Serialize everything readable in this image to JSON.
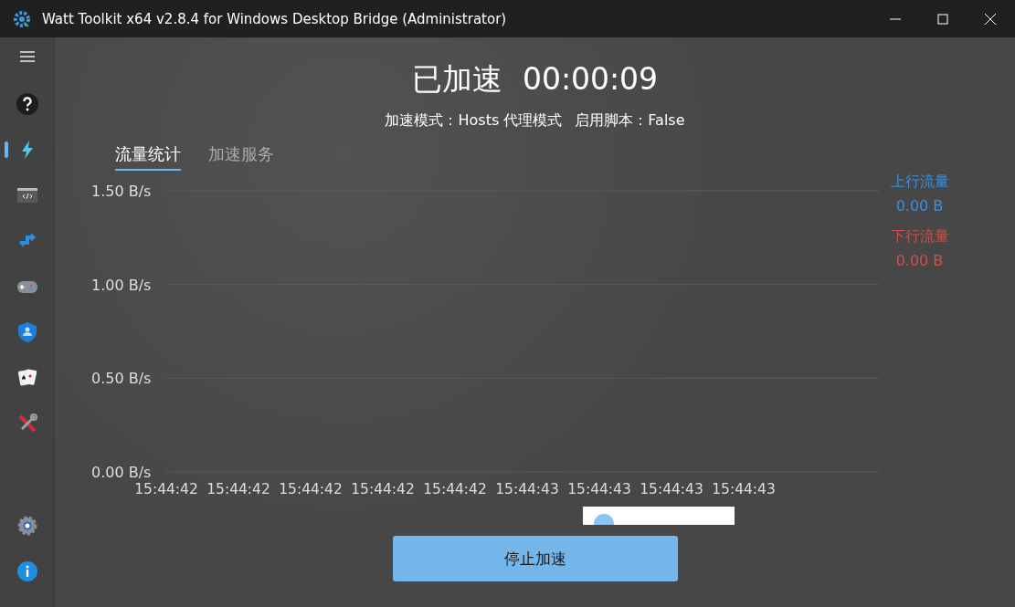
{
  "window": {
    "title": "Watt Toolkit x64 v2.8.4 for Windows Desktop Bridge (Administrator)"
  },
  "sidebar": {
    "items": [
      {
        "kind": "help",
        "selected": false
      },
      {
        "kind": "accelerate",
        "selected": true
      },
      {
        "kind": "script",
        "selected": false
      },
      {
        "kind": "proxy",
        "selected": false
      },
      {
        "kind": "game",
        "selected": false
      },
      {
        "kind": "account",
        "selected": false
      },
      {
        "kind": "cards",
        "selected": false
      },
      {
        "kind": "tools",
        "selected": false
      }
    ],
    "bottom_items": [
      {
        "kind": "settings",
        "selected": false
      },
      {
        "kind": "about",
        "selected": false
      }
    ]
  },
  "status": {
    "label": "已加速",
    "timer": "00:00:09",
    "mode": "加速模式：Hosts 代理模式",
    "script": "启用脚本：False"
  },
  "tabs": [
    {
      "label": "流量统计",
      "selected": true
    },
    {
      "label": "加速服务",
      "selected": false
    }
  ],
  "chart_data": {
    "type": "line",
    "categories": [
      "15:44:42",
      "15:44:42",
      "15:44:42",
      "15:44:42",
      "15:44:42",
      "15:44:43",
      "15:44:43",
      "15:44:43",
      "15:44:43"
    ],
    "ylim": [
      0,
      1.5
    ],
    "yticks": [
      {
        "value": 0,
        "label": "0.00 B/s"
      },
      {
        "value": 0.5,
        "label": "0.50 B/s"
      },
      {
        "value": 1,
        "label": "1.00 B/s"
      },
      {
        "value": 1.5,
        "label": "1.50 B/s"
      }
    ]
  },
  "legend": [
    {
      "label": "上行流量",
      "total": "0.00 B",
      "color": "#3b8fe0"
    },
    {
      "label": "下行流量",
      "total": "0.00 B",
      "color": "#c9514f"
    }
  ],
  "stop_button": "停止加速"
}
